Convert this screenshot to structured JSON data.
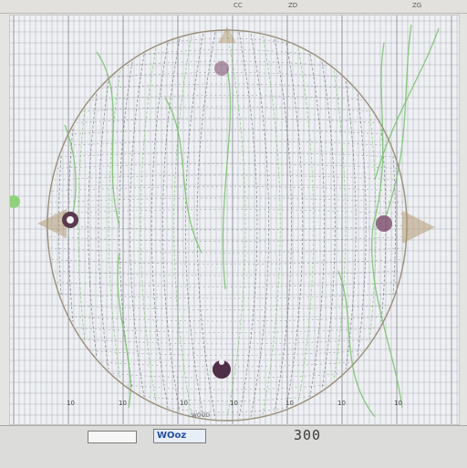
{
  "window": {
    "top_labels": [
      "CC",
      "ZD",
      "ZG"
    ]
  },
  "plot": {
    "colors": {
      "grid": "#8b8f99",
      "mesh": "#6b6f78",
      "green": "#76c26a",
      "purple": "#7a4a6a",
      "tan": "#b7a06a"
    },
    "axis_labels": [
      "10",
      "10",
      "10",
      "10",
      "10",
      "10",
      "10"
    ],
    "bottom_label": "WOOD"
  },
  "bottom_bar": {
    "field_value": "",
    "button_label": "WOoz",
    "scale_value": "300"
  }
}
